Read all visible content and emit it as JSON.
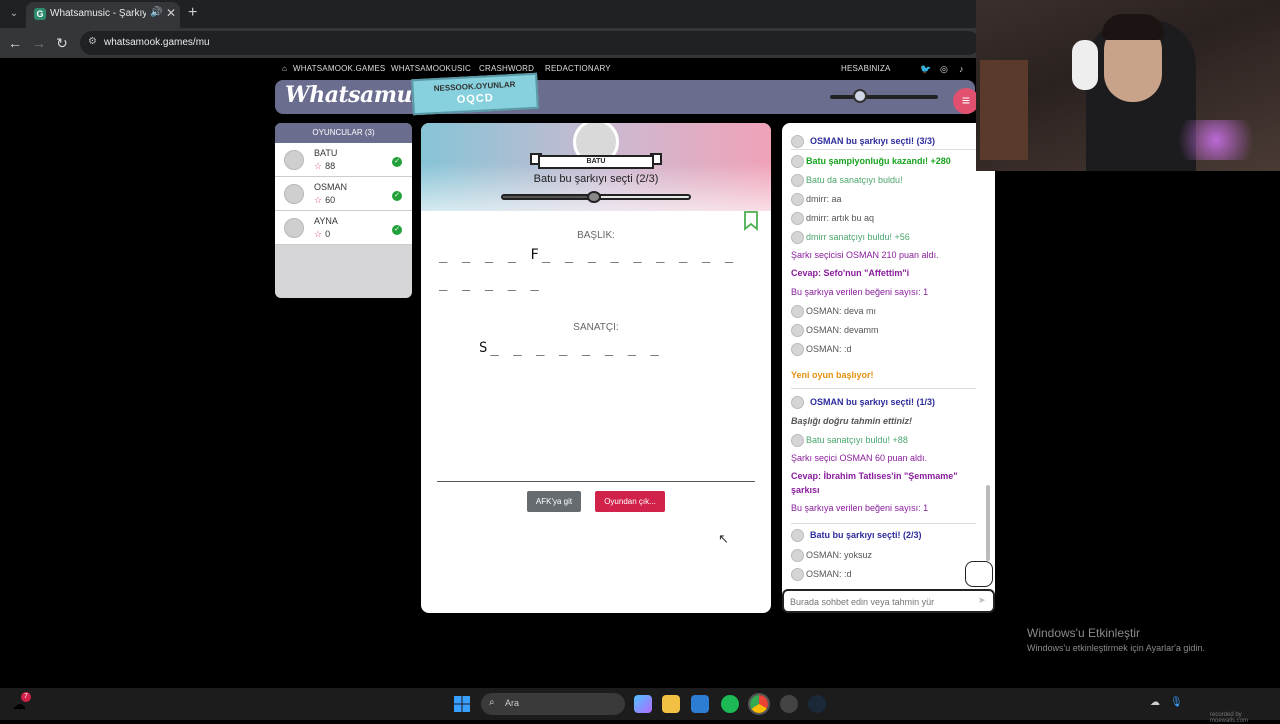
{
  "browser": {
    "tab_title": "Whatsamusic - Şarkıyı Tahmin Et",
    "tab_favicon": "G",
    "url": "whatsamook.games/mu"
  },
  "site_nav": {
    "items": [
      "WHATSAMOOK.GAMES",
      "WHATSAMOOKUSIC",
      "CRASHWORD",
      "REDACTIONARY"
    ],
    "account": "HESABINIZA"
  },
  "header": {
    "logo": "Whatsamusic",
    "badge_line1": "NESSOOK.OYUNLAR",
    "badge_line2": "OQCD",
    "volume_level": 0.28
  },
  "players": {
    "title": "OYUNCULAR (3)",
    "list": [
      {
        "name": "BATU",
        "score": "88"
      },
      {
        "name": "OSMAN",
        "score": "60"
      },
      {
        "name": "AYNA",
        "score": "0"
      }
    ]
  },
  "game": {
    "chooser_name": "BATU",
    "chooser_text": "Batu bu şarkıyı seçti (2/3)",
    "timer_progress": 0.5,
    "title_label": "BAŞLIK:",
    "title_hint_line1": "_ _ _ _ F_ _ _ _ _ _ _ _ _",
    "title_hint_line2": "_ _ _ _ _",
    "artist_label": "SANATÇI:",
    "artist_hint": "S_ _ _ _ _ _ _ _",
    "afk_button": "AFK'ya git",
    "leave_button": "Oyundan çık..."
  },
  "chat": {
    "messages": [
      {
        "text": "OSMAN bu şarkıyı seçti! (3/3)",
        "avatar": true,
        "style": "blue"
      },
      {
        "text": "Batu şampiyonluğu kazandı! +280",
        "avatar": true,
        "style": "green"
      },
      {
        "text": "Batu da sanatçıyı buldu!",
        "avatar": true,
        "style": "grn2"
      },
      {
        "text": "dmirr: aa",
        "avatar": true,
        "style": "gray"
      },
      {
        "text": "dmirr: artık bu aq",
        "avatar": true,
        "style": "gray"
      },
      {
        "text": "dmirr sanatçıyı buldu! +56",
        "avatar": true,
        "style": "grn2"
      },
      {
        "text": "Şarkı seçicisi OSMAN 210 puan aldı.",
        "avatar": false,
        "style": "purple"
      },
      {
        "text": "Cevap: Sefo'nun \"Affettim\"i",
        "avatar": false,
        "style": "purple-b"
      },
      {
        "text": "Bu şarkıya verilen beğeni sayısı: 1",
        "avatar": false,
        "style": "purple"
      },
      {
        "text": "OSMAN: deva mı",
        "avatar": true,
        "style": "gray"
      },
      {
        "text": "OSMAN: devamm",
        "avatar": true,
        "style": "gray"
      },
      {
        "text": "OSMAN: :d",
        "avatar": true,
        "style": "gray"
      },
      {
        "text": "Yeni oyun başlıyor!",
        "avatar": false,
        "style": "orange"
      },
      {
        "text": "OSMAN bu şarkıyı seçti! (1/3)",
        "avatar": true,
        "style": "blue"
      },
      {
        "text": "Başlığı doğru tahmin ettiniz!",
        "avatar": false,
        "style": "italic"
      },
      {
        "text": "Batu sanatçıyı buldu! +88",
        "avatar": true,
        "style": "grn2"
      },
      {
        "text": "Şarkı seçici OSMAN 60 puan aldı.",
        "avatar": false,
        "style": "purple"
      },
      {
        "text": "Cevap: İbrahim Tatlıses'in \"Şemmame\"",
        "avatar": false,
        "style": "purple-b"
      },
      {
        "text": "şarkısı",
        "avatar": false,
        "style": "purple-b"
      },
      {
        "text": "Bu şarkıya verilen beğeni sayısı: 1",
        "avatar": false,
        "style": "purple"
      },
      {
        "text": "Batu bu şarkıyı seçti! (2/3)",
        "avatar": true,
        "style": "blue"
      },
      {
        "text": "OSMAN: yoksuz",
        "avatar": true,
        "style": "gray"
      },
      {
        "text": "OSMAN: :d",
        "avatar": true,
        "style": "gray"
      }
    ],
    "input_placeholder": "Burada sohbet edin veya tahmin yür"
  },
  "watermark": {
    "line1": "Windows'u Etkinleştir",
    "line2": "Windows'u etkinleştirmek için Ayarlar'a gidin."
  },
  "taskbar": {
    "search_text": "Ara",
    "weather_badge": "7",
    "recorder_text": "recorded by moewalls.com"
  },
  "colors": {
    "header_bg": "#6b6d8f",
    "accent_pink": "#e25070",
    "leave_red": "#d0224a",
    "afk_gray": "#666b70",
    "check_green": "#22a03a"
  }
}
